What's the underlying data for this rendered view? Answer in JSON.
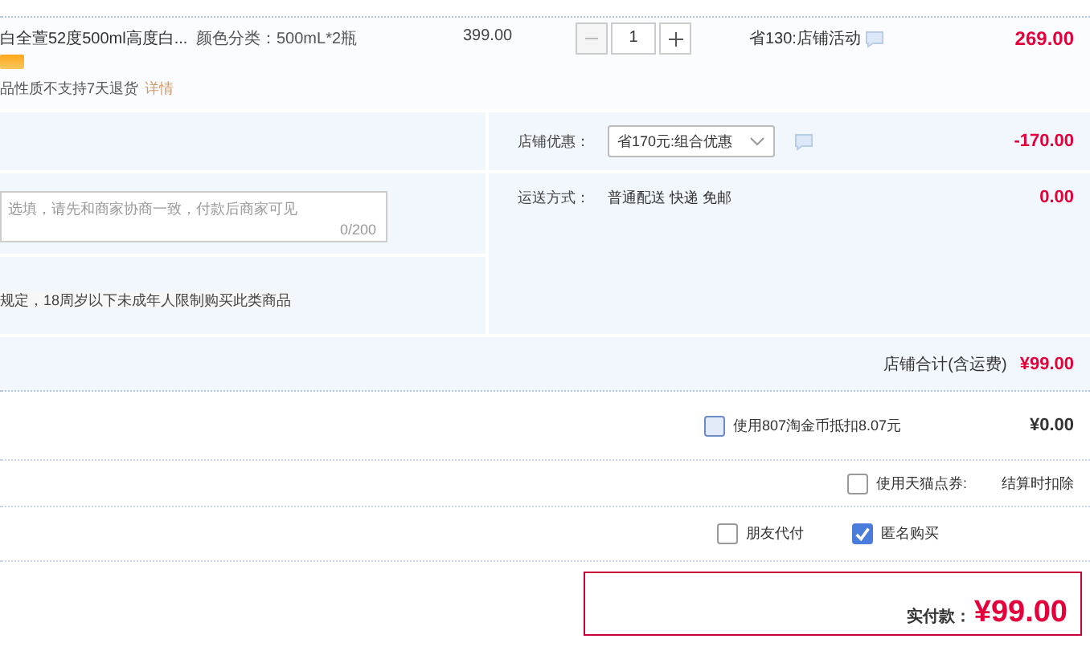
{
  "item": {
    "name": "白全萱52度500ml高度白...",
    "spec": "颜色分类：500mL*2瓶",
    "price": "399.00",
    "quantity": "1",
    "promo": "省130:店铺活动",
    "total": "269.00",
    "notice": "品性质不支持7天退货",
    "notice_link": "详情"
  },
  "order": {
    "message_placeholder": "选填，请先和商家协商一致，付款后商家可见",
    "message_count": "0/200",
    "age_notice": "规定，18周岁以下未成年人限制购买此类商品",
    "discount_label": "店铺优惠：",
    "discount_select": "省170元:组合优惠",
    "discount_amount": "-170.00",
    "shipping_label": "运送方式：",
    "shipping_value": "普通配送 快递 免邮",
    "shipping_amount": "0.00",
    "subtotal_label": "店铺合计(含运费)",
    "subtotal": "¥99.00"
  },
  "options": [
    {
      "kind": "coins",
      "label": "使用807淘金币抵扣8.07元",
      "checked": false,
      "value": "¥0.00"
    },
    {
      "kind": "coupon",
      "label": "使用天猫点券:",
      "checked": false,
      "value": "结算时扣除"
    }
  ],
  "extras": [
    {
      "label": "朋友代付",
      "checked": false
    },
    {
      "label": "匿名购买",
      "checked": true
    }
  ],
  "payment": {
    "label": "实付款：",
    "amount": "¥99.00"
  }
}
